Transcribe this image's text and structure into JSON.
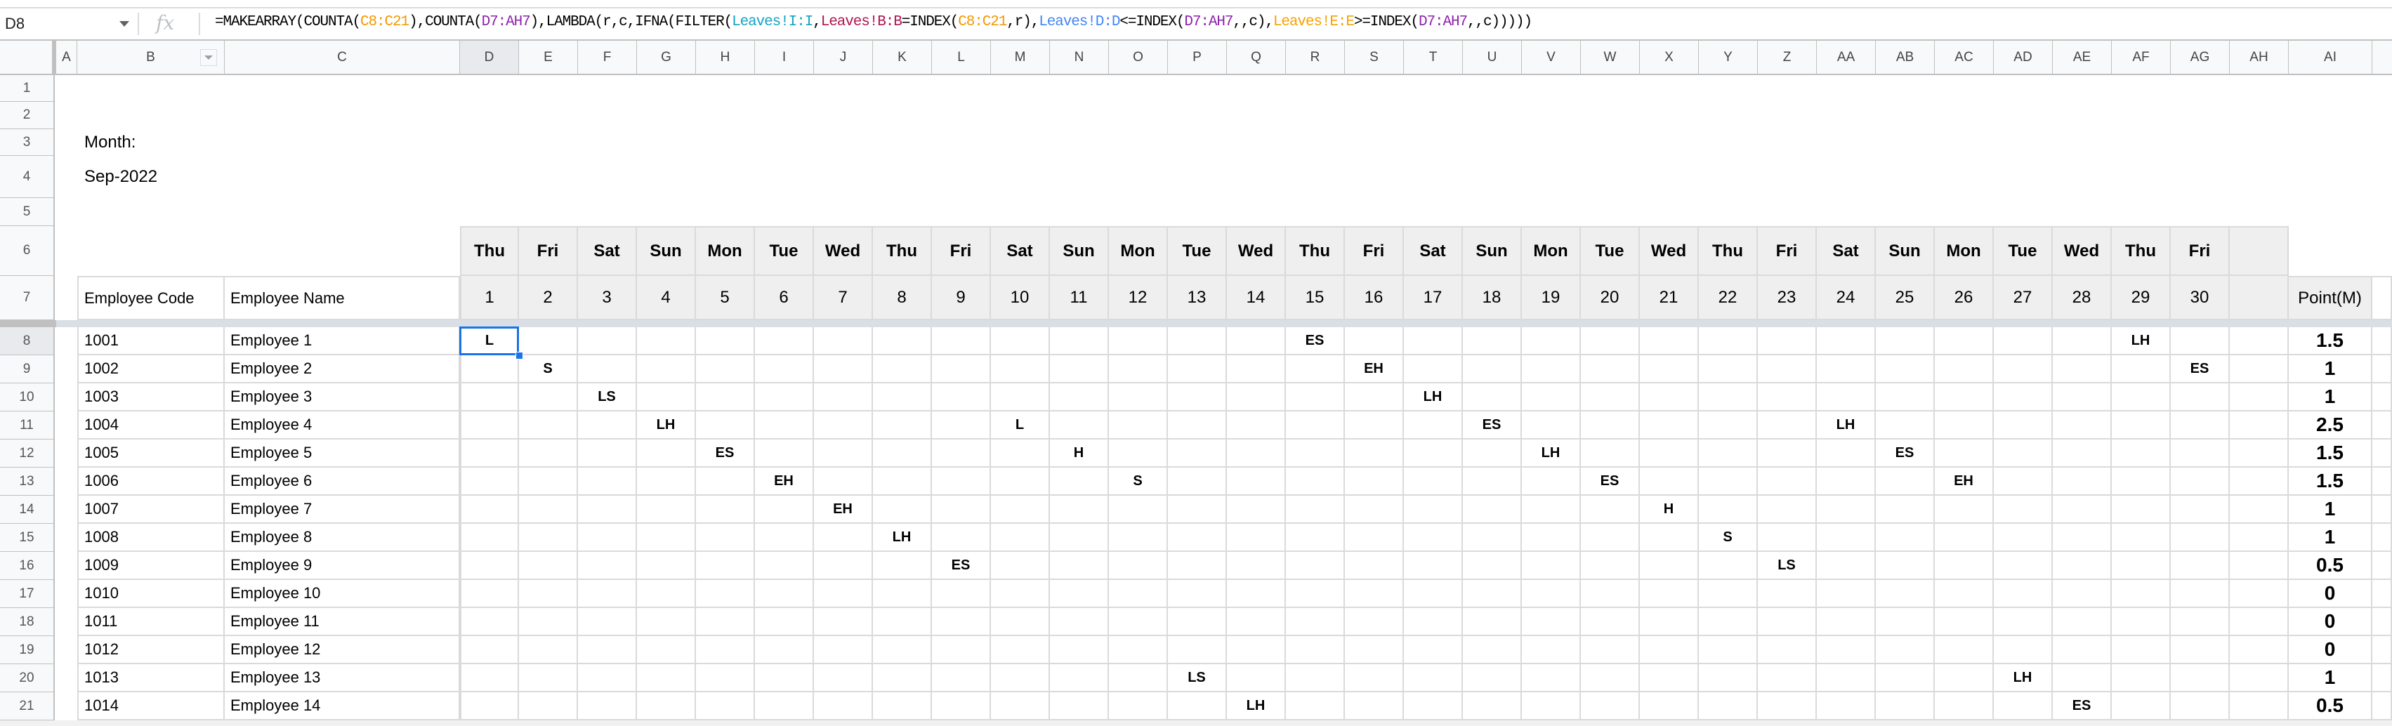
{
  "formula_bar": {
    "name_box": "D8",
    "fx_icon": "fx",
    "formula_parts": [
      {
        "text": "=MAKEARRAY(COUNTA(",
        "color": "default"
      },
      {
        "text": "C8:C21",
        "color": "orange"
      },
      {
        "text": "),COUNTA(",
        "color": "default"
      },
      {
        "text": "D7:AH7",
        "color": "purple"
      },
      {
        "text": "),LAMBDA(r,c,IFNA(FILTER(",
        "color": "default"
      },
      {
        "text": "Leaves!I:I",
        "color": "teal"
      },
      {
        "text": ",",
        "color": "default"
      },
      {
        "text": "Leaves!B:B",
        "color": "crimson"
      },
      {
        "text": "=INDEX(",
        "color": "default"
      },
      {
        "text": "C8:C21",
        "color": "orange"
      },
      {
        "text": ",r),",
        "color": "default"
      },
      {
        "text": "Leaves!D:D",
        "color": "blue"
      },
      {
        "text": "<=INDEX(",
        "color": "default"
      },
      {
        "text": "D7:AH7",
        "color": "purple"
      },
      {
        "text": ",,c),",
        "color": "default"
      },
      {
        "text": "Leaves!E:E",
        "color": "yellow"
      },
      {
        "text": ">=INDEX(",
        "color": "default"
      },
      {
        "text": "D7:AH7",
        "color": "purple"
      },
      {
        "text": ",,c)))))",
        "color": "default"
      }
    ]
  },
  "column_headers": [
    "A",
    "B",
    "C",
    "D",
    "E",
    "F",
    "G",
    "H",
    "I",
    "J",
    "K",
    "L",
    "M",
    "N",
    "O",
    "P",
    "Q",
    "R",
    "S",
    "T",
    "U",
    "V",
    "W",
    "X",
    "Y",
    "Z",
    "AA",
    "AB",
    "AC",
    "AD",
    "AE",
    "AF",
    "AG",
    "AH",
    "AI"
  ],
  "selected_column": "D",
  "row_numbers": [
    1,
    2,
    3,
    4,
    5,
    6,
    7,
    8,
    9,
    10,
    11,
    12,
    13,
    14,
    15,
    16,
    17,
    18,
    19,
    20,
    21
  ],
  "selected_row": 8,
  "sheet": {
    "month_label": "Month:",
    "month_value": "Sep-2022",
    "header": {
      "code": "Employee Code",
      "name": "Employee Name",
      "points": "Point(M)"
    },
    "weekdays": [
      "Thu",
      "Fri",
      "Sat",
      "Sun",
      "Mon",
      "Tue",
      "Wed",
      "Thu",
      "Fri",
      "Sat",
      "Sun",
      "Mon",
      "Tue",
      "Wed",
      "Thu",
      "Fri",
      "Sat",
      "Sun",
      "Mon",
      "Tue",
      "Wed",
      "Thu",
      "Fri",
      "Sat",
      "Sun",
      "Mon",
      "Tue",
      "Wed",
      "Thu",
      "Fri"
    ],
    "days": [
      "1",
      "2",
      "3",
      "4",
      "5",
      "6",
      "7",
      "8",
      "9",
      "10",
      "11",
      "12",
      "13",
      "14",
      "15",
      "16",
      "17",
      "18",
      "19",
      "20",
      "21",
      "22",
      "23",
      "24",
      "25",
      "26",
      "27",
      "28",
      "29",
      "30"
    ],
    "employees": [
      {
        "code": "1001",
        "name": "Employee 1",
        "leaves": {
          "1": "L",
          "15": "ES",
          "29": "LH"
        },
        "points": "1.5"
      },
      {
        "code": "1002",
        "name": "Employee 2",
        "leaves": {
          "2": "S",
          "16": "EH",
          "30": "ES"
        },
        "points": "1"
      },
      {
        "code": "1003",
        "name": "Employee 3",
        "leaves": {
          "3": "LS",
          "17": "LH"
        },
        "points": "1"
      },
      {
        "code": "1004",
        "name": "Employee 4",
        "leaves": {
          "4": "LH",
          "10": "L",
          "18": "ES",
          "24": "LH"
        },
        "points": "2.5"
      },
      {
        "code": "1005",
        "name": "Employee 5",
        "leaves": {
          "5": "ES",
          "11": "H",
          "19": "LH",
          "25": "ES"
        },
        "points": "1.5"
      },
      {
        "code": "1006",
        "name": "Employee 6",
        "leaves": {
          "6": "EH",
          "12": "S",
          "20": "ES",
          "26": "EH"
        },
        "points": "1.5"
      },
      {
        "code": "1007",
        "name": "Employee 7",
        "leaves": {
          "7": "EH",
          "21": "H"
        },
        "points": "1"
      },
      {
        "code": "1008",
        "name": "Employee 8",
        "leaves": {
          "8": "LH",
          "22": "S"
        },
        "points": "1"
      },
      {
        "code": "1009",
        "name": "Employee 9",
        "leaves": {
          "9": "ES",
          "23": "LS"
        },
        "points": "0.5"
      },
      {
        "code": "1010",
        "name": "Employee 10",
        "leaves": {},
        "points": "0"
      },
      {
        "code": "1011",
        "name": "Employee 11",
        "leaves": {},
        "points": "0"
      },
      {
        "code": "1012",
        "name": "Employee 12",
        "leaves": {},
        "points": "0"
      },
      {
        "code": "1013",
        "name": "Employee 13",
        "leaves": {
          "13": "LS",
          "27": "LH"
        },
        "points": "1"
      },
      {
        "code": "1014",
        "name": "Employee 14",
        "leaves": {
          "14": "LH",
          "28": "ES"
        },
        "points": "0.5"
      }
    ]
  },
  "colors": {
    "selection": "#1a73e8",
    "header_fill": "#efefef",
    "formula_orange": "#f29900",
    "formula_purple": "#8e24aa",
    "formula_teal": "#12a4c2",
    "formula_crimson": "#b0154f",
    "formula_blue": "#4285f4",
    "formula_yellow": "#f4a300"
  }
}
